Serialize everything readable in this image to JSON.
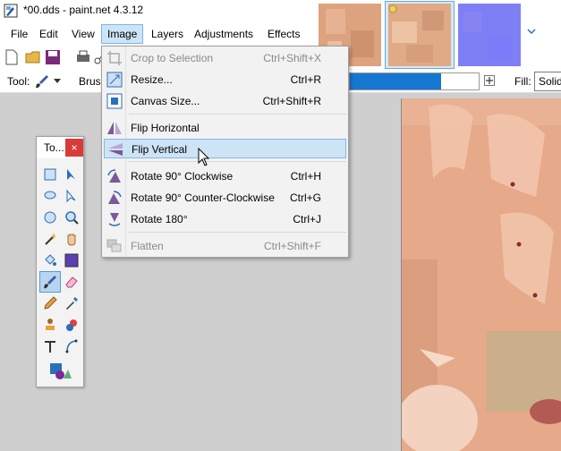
{
  "window": {
    "title": "*00.dds - paint.net 4.3.12"
  },
  "menubar": {
    "items": [
      {
        "label": "File"
      },
      {
        "label": "Edit"
      },
      {
        "label": "View"
      },
      {
        "label": "Image"
      },
      {
        "label": "Layers"
      },
      {
        "label": "Adjustments"
      },
      {
        "label": "Effects"
      }
    ]
  },
  "toolbar": {
    "tool_label": "Tool:",
    "brush_label": "Brush",
    "brush_size_fraction": 0.71,
    "fill_label": "Fill:",
    "fill_value": "Solid"
  },
  "tools_window": {
    "title": "To...",
    "close": "×"
  },
  "image_menu": {
    "items": [
      {
        "label": "Crop to Selection",
        "shortcut": "Ctrl+Shift+X",
        "enabled": false,
        "icon": "crop-icon"
      },
      {
        "label": "Resize...",
        "shortcut": "Ctrl+R",
        "enabled": true,
        "icon": "resize-icon"
      },
      {
        "label": "Canvas Size...",
        "shortcut": "Ctrl+Shift+R",
        "enabled": true,
        "icon": "canvas-size-icon"
      },
      {
        "label": "Flip Horizontal",
        "shortcut": "",
        "enabled": true,
        "icon": "flip-horizontal-icon"
      },
      {
        "label": "Flip Vertical",
        "shortcut": "",
        "enabled": true,
        "icon": "flip-vertical-icon"
      },
      {
        "label": "Rotate 90° Clockwise",
        "shortcut": "Ctrl+H",
        "enabled": true,
        "icon": "rotate-cw-icon"
      },
      {
        "label": "Rotate 90° Counter-Clockwise",
        "shortcut": "Ctrl+G",
        "enabled": true,
        "icon": "rotate-ccw-icon"
      },
      {
        "label": "Rotate 180°",
        "shortcut": "Ctrl+J",
        "enabled": true,
        "icon": "rotate-180-icon"
      },
      {
        "label": "Flatten",
        "shortcut": "Ctrl+Shift+F",
        "enabled": false,
        "icon": "flatten-icon"
      }
    ]
  },
  "colors": {
    "accent": "#1677d2",
    "menu_hover": "#cde3f6",
    "close_red": "#d93a3a",
    "skin": "#e8b08e",
    "normal_map": "#7f7ff5"
  }
}
